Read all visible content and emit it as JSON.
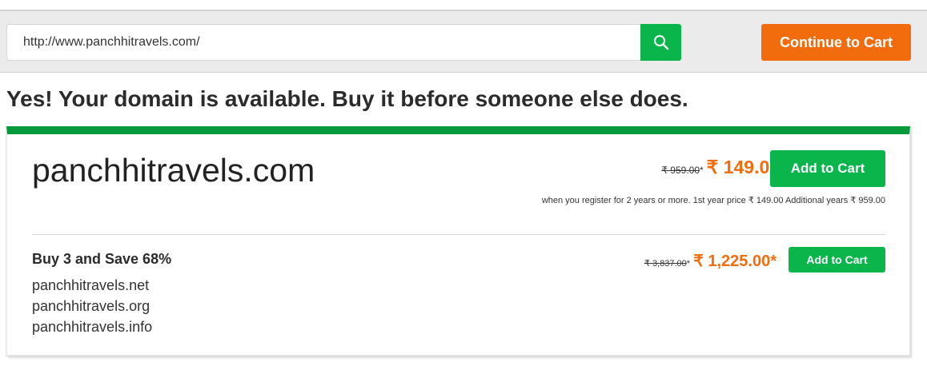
{
  "search": {
    "value": "http://www.panchhitravels.com/",
    "icon": "search-icon"
  },
  "header": {
    "continue_label": "Continue to Cart"
  },
  "headline": "Yes! Your domain is available. Buy it before someone else does.",
  "colors": {
    "accent_green": "#0ab54c",
    "card_border_green": "#079a3c",
    "accent_orange": "#f26c0d"
  },
  "primary": {
    "domain": "panchhitravels.com",
    "old_price": "₹ 959.00",
    "old_price_mark": "*",
    "new_price": "₹ 149.00*",
    "add_label": "Add to Cart",
    "note": "when you register for 2 years or more. 1st year price ₹ 149.00 Additional years ₹ 959.00"
  },
  "bundle": {
    "title": "Buy 3 and Save 68%",
    "domains": [
      "panchhitravels.net",
      "panchhitravels.org",
      "panchhitravels.info"
    ],
    "old_price": "₹ 3,837.00",
    "old_price_mark": "*",
    "new_price": "₹ 1,225.00*",
    "add_label": "Add to Cart"
  }
}
